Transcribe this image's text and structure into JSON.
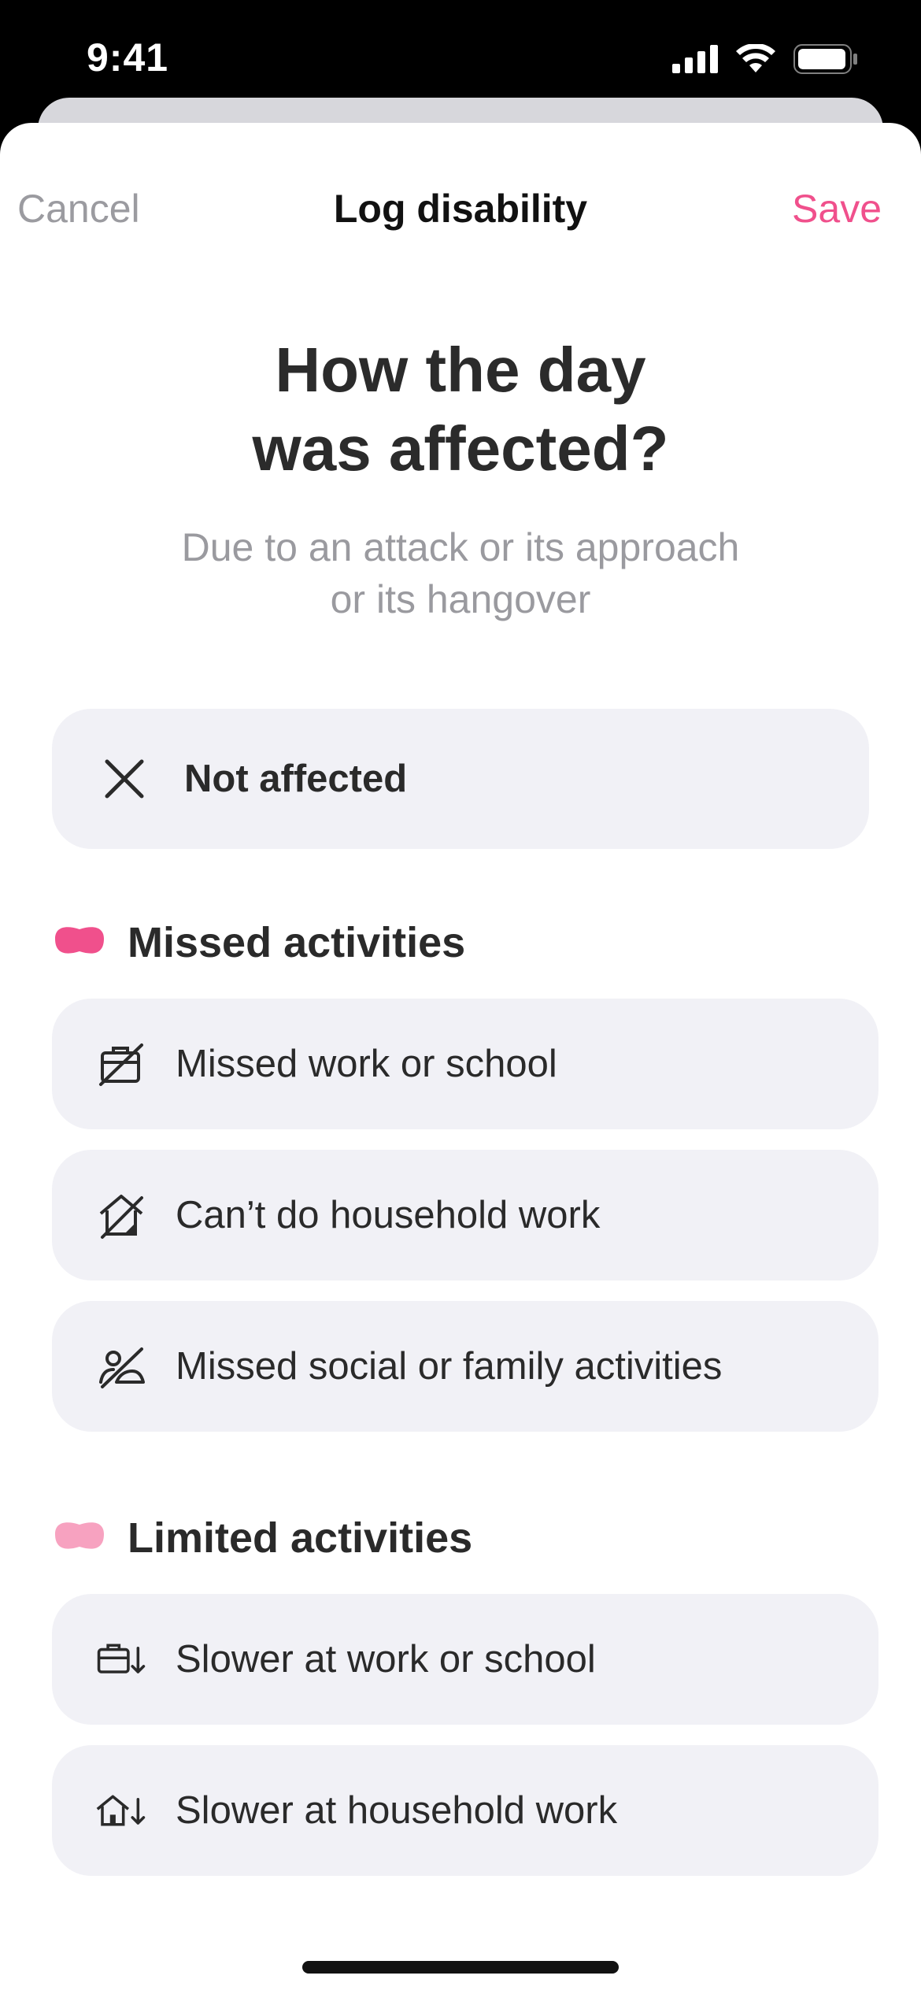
{
  "status_bar": {
    "time": "9:41"
  },
  "nav": {
    "cancel": "Cancel",
    "title": "Log disability",
    "save": "Save"
  },
  "header": {
    "title_line1": "How the day",
    "title_line2": "was affected?",
    "subtitle_line1": "Due to an attack or its approach",
    "subtitle_line2": "or its hangover"
  },
  "not_affected": {
    "label": "Not affected",
    "icon": "close-icon"
  },
  "sections": [
    {
      "title": "Missed activities",
      "color": "#f0508c",
      "options": [
        {
          "label": "Missed work or school",
          "icon": "work-off-icon"
        },
        {
          "label": "Can’t do household work",
          "icon": "home-off-icon"
        },
        {
          "label": "Missed social or family activities",
          "icon": "social-off-icon"
        }
      ]
    },
    {
      "title": "Limited activities",
      "color": "#f7a2c0",
      "options": [
        {
          "label": "Slower at work or school",
          "icon": "briefcase-down-icon"
        },
        {
          "label": "Slower at household work",
          "icon": "home-down-icon"
        }
      ]
    }
  ],
  "colors": {
    "accent": "#f0508c",
    "option_bg": "#f1f1f6",
    "muted_text": "#9a9a9f"
  }
}
